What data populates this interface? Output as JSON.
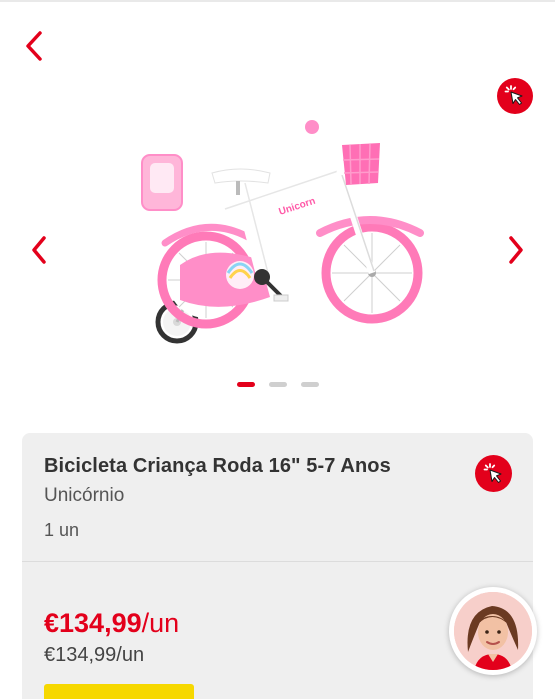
{
  "colors": {
    "accent": "#e3001b",
    "card_bg": "#efefef",
    "promo_yellow": "#f6d800"
  },
  "icons": {
    "back": "chevron-left-icon",
    "click_badge": "cursor-click-icon",
    "gallery_prev": "chevron-left-icon",
    "gallery_next": "chevron-right-icon",
    "assistant": "assistant-avatar"
  },
  "gallery": {
    "total_images": 3,
    "active_index": 0
  },
  "product": {
    "title": "Bicicleta Criança Roda 16\" 5-7 Anos",
    "variant": "Unicórnio",
    "quantity": "1 un",
    "price_main": "€134,99",
    "price_main_unit": "/un",
    "price_sub": "€134,99/un"
  }
}
